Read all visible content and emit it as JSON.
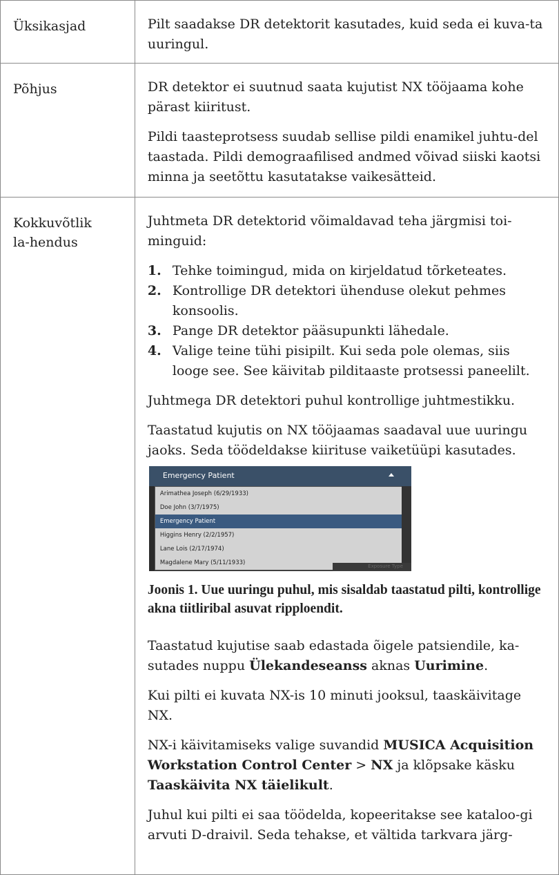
{
  "rows": [
    {
      "label": "Üksikasjad",
      "text": "Pilt saadakse DR detektorit kasutades, kuid seda ei kuva-ta uuringul."
    },
    {
      "label": "Põhjus",
      "p1": "DR detektor ei suutnud saata kujutist NX tööjaama kohe pärast kiiritust.",
      "p2": "Pildi taasteprotsess suudab sellise pildi enamikel juhtu-del taastada. Pildi demograafilised andmed võivad siiski kaotsi minna ja seetõttu kasutatakse vaikesätteid."
    },
    {
      "label": "Kokkuvõtlik la-hendus",
      "intro": "Juhtmeta DR detektorid võimaldavad teha järgmisi toi-minguid:",
      "steps": [
        {
          "num": "1.",
          "text": "Tehke toimingud, mida on kirjeldatud tõrketeates."
        },
        {
          "num": "2.",
          "text": "Kontrollige DR detektori ühenduse olekut pehmes konsoolis."
        },
        {
          "num": "3.",
          "text": "Pange DR detektor pääsupunkti lähedale."
        },
        {
          "num": "4.",
          "text": "Valige teine tühi pisipilt. Kui seda pole olemas, siis looge see. See käivitab pilditaaste protsessi paneelilt."
        }
      ],
      "wired": "Juhtmega DR detektori puhul kontrollige juhtmestikku.",
      "restored": "Taastatud kujutis on NX tööjaamas saadaval uue uuringu jaoks. Seda töödeldakse kiirituse vaiketüüpi kasutades.",
      "screenshot": {
        "title": "Emergency Patient",
        "items": [
          "Arimathea Joseph (6/29/1933)",
          "Doe John (3/7/1975)",
          "Emergency Patient",
          "Higgins Henry (2/2/1957)",
          "Lane Lois (2/17/1974)",
          "Magdalene Mary (5/11/1933)"
        ],
        "selected_index": 2,
        "footer": "Exposure Type"
      },
      "caption": "Joonis 1. Uue uuringu puhul, mis sisaldab taastatud pilti, kontrollige akna tiitliribal asuvat ripploendit.",
      "transfer_a": "Taastatud kujutise saab edastada õigele patsiendile, ka-sutades nuppu ",
      "transfer_b1": "Ülekandeseanss",
      "transfer_c": " aknas ",
      "transfer_b2": "Uurimine",
      "transfer_d": ".",
      "restart": "Kui pilti ei kuvata NX-is 10 minuti jooksul, taaskäivitage NX.",
      "launch_a": "NX-i käivitamiseks valige suvandid ",
      "launch_b1": "MUSICA Acquisition Workstation Control Center",
      "launch_sep": " > ",
      "launch_b2": "NX",
      "launch_c": " ja klõpsake käsku ",
      "launch_b3": "Taaskäivita NX täielikult",
      "launch_d": ".",
      "last": "Juhul kui pilti ei saa töödelda, kopeeritakse see kataloo-gi arvuti D-draivil. Seda tehakse, et vältida tarkvara järg-"
    }
  ]
}
